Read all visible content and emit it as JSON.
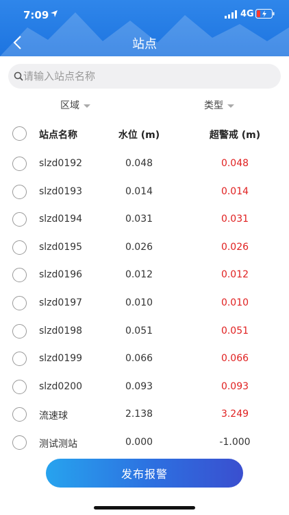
{
  "status_bar": {
    "time": "7:09",
    "network": "4G",
    "colors": {
      "battery_charge": "#34c759",
      "battery_low": "#ff3b30"
    }
  },
  "nav": {
    "title": "站点",
    "back_icon": "chevron-left-icon"
  },
  "search": {
    "placeholder": "请输入站点名称",
    "value": ""
  },
  "filters": {
    "region_label": "区域",
    "type_label": "类型"
  },
  "table": {
    "headers": {
      "name": "站点名称",
      "level": "水位 (m)",
      "warning": "超警戒 (m)"
    },
    "rows": [
      {
        "name": "slzd0192",
        "level": "0.048",
        "warning": "0.048",
        "negative": false
      },
      {
        "name": "slzd0193",
        "level": "0.014",
        "warning": "0.014",
        "negative": false
      },
      {
        "name": "slzd0194",
        "level": "0.031",
        "warning": "0.031",
        "negative": false
      },
      {
        "name": "slzd0195",
        "level": "0.026",
        "warning": "0.026",
        "negative": false
      },
      {
        "name": "slzd0196",
        "level": "0.012",
        "warning": "0.012",
        "negative": false
      },
      {
        "name": "slzd0197",
        "level": "0.010",
        "warning": "0.010",
        "negative": false
      },
      {
        "name": "slzd0198",
        "level": "0.051",
        "warning": "0.051",
        "negative": false
      },
      {
        "name": "slzd0199",
        "level": "0.066",
        "warning": "0.066",
        "negative": false
      },
      {
        "name": "slzd0200",
        "level": "0.093",
        "warning": "0.093",
        "negative": false
      },
      {
        "name": "流速球",
        "level": "2.138",
        "warning": "3.249",
        "negative": false
      },
      {
        "name": "测试测站",
        "level": "0.000",
        "warning": "-1.000",
        "negative": true
      }
    ]
  },
  "actions": {
    "publish_label": "发布报警"
  },
  "colors": {
    "header": "#2f86ea",
    "warning_text": "#e02020",
    "accent": "#2d6fe0"
  }
}
